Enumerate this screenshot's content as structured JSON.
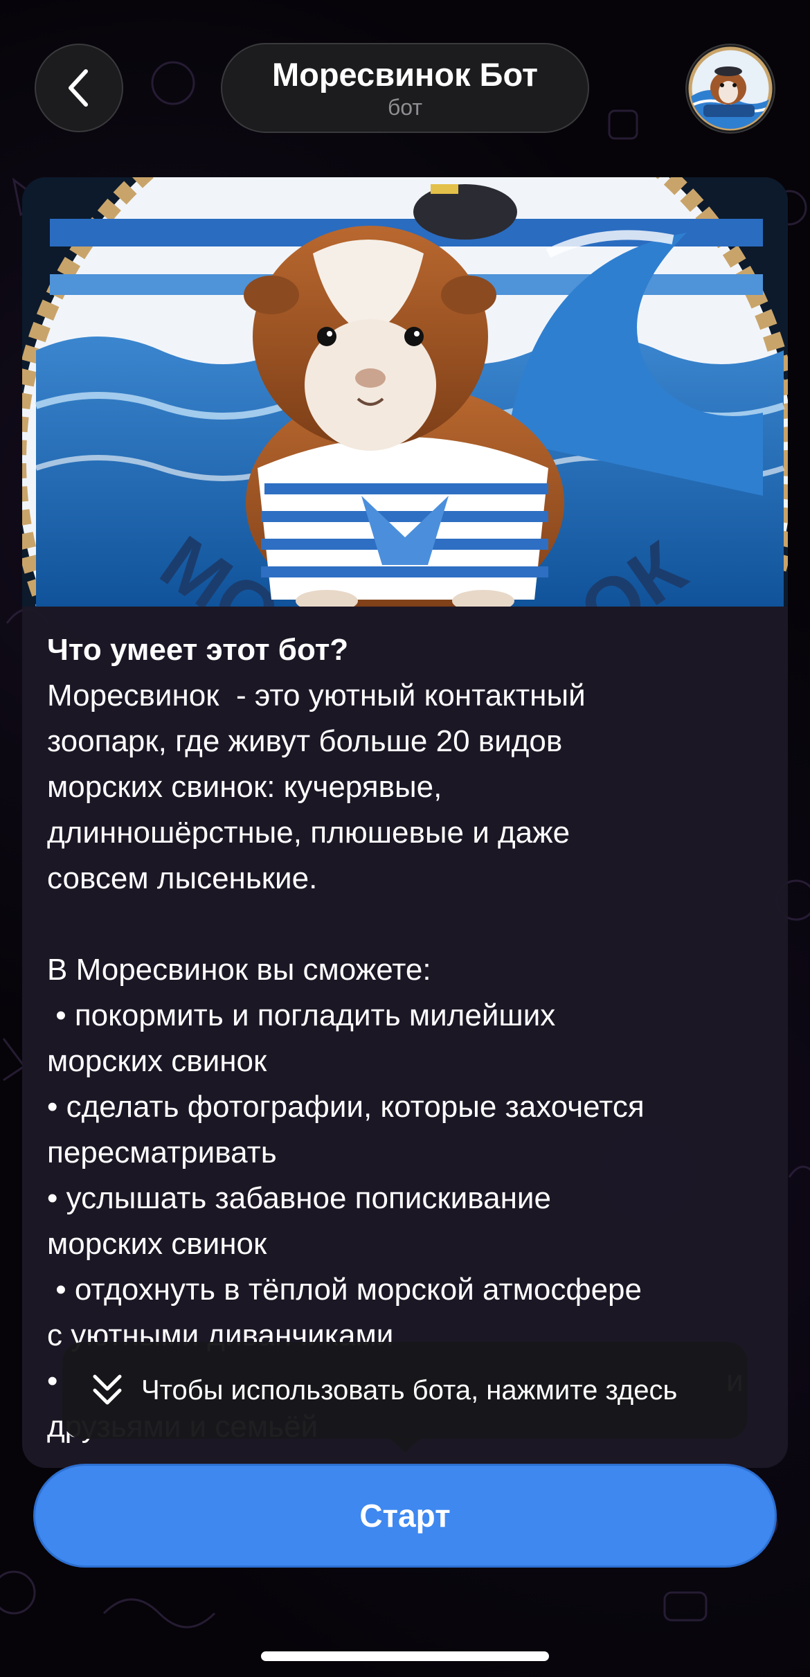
{
  "header": {
    "bot_name": "Моресвинок Бот",
    "bot_subtitle": "бот",
    "back_icon": "chevron-left-icon",
    "avatar_icon": "bot-avatar"
  },
  "card": {
    "heading": "Что умеет этот бот?",
    "description_lines": [
      "Моресвинок  - это уютный контактный",
      "зоопарк, где живут больше 20 видов",
      "морских свинок: кучерявые,",
      "длинношёрстные, плюшевые и даже",
      "совсем лысенькие.",
      "",
      "В Моресвинок вы сможете:",
      " • покормить и погладить милейших",
      "морских свинок",
      "• сделать фотографии, которые захочется",
      "пересматривать",
      "• услышать забавное попискивание",
      "морских свинок",
      " • отдохнуть в тёплой морской атмосфере",
      "с уютными диванчиками",
      "•                                                                               и",
      "друзьями и семьёй"
    ],
    "hero_logo_text": "МОРЕСВИНОК"
  },
  "tooltip": {
    "text": "Чтобы использовать бота, нажмите здесь",
    "icon": "double-chevron-down-icon"
  },
  "start_button": {
    "label": "Старт"
  },
  "colors": {
    "accent": "#3e88f0",
    "background": "#060409",
    "card": "#1d1826"
  }
}
